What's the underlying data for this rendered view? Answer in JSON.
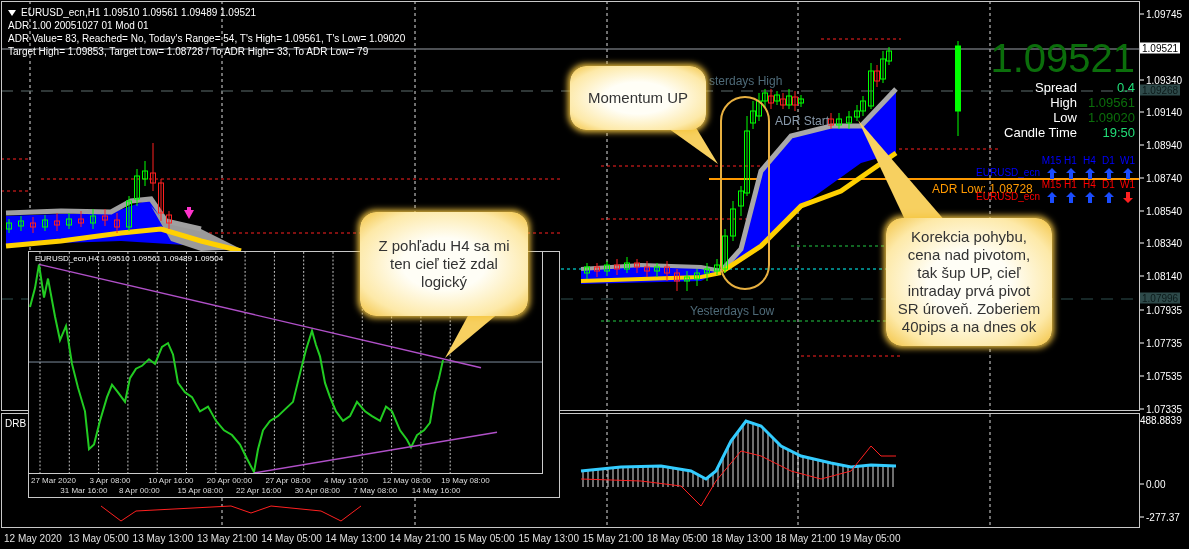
{
  "header": {
    "symbol_line": "EURUSD_ecn,H1  1.09510 1.09561 1.09489 1.09521",
    "lines": [
      "ADR 1.00 20051027 01 Mod 01",
      "ADR Value= 83, Reached= No, Today's Range= 54, T's High= 1.09561, T's Low= 1.09020",
      "Target High= 1.09853, Target Low= 1.08728 / To ADR High= 33, To ADR Low= 79"
    ]
  },
  "price_panel": {
    "price": "1.09521",
    "rows": [
      {
        "label": "Spread",
        "value": "0.4",
        "color": "#22dd77"
      },
      {
        "label": "High",
        "value": "1.09561",
        "color": "#0b6e0b"
      },
      {
        "label": "Low",
        "value": "1.09020",
        "color": "#0b6e0b"
      },
      {
        "label": "Candle Time",
        "value": "19:50",
        "color": "#22dd77"
      }
    ]
  },
  "trend_table": {
    "rows": [
      {
        "symbol": "EURUSD_ecn",
        "color": "#0000ff",
        "timeframes": [
          {
            "label": "M15",
            "rising": true
          },
          {
            "label": "H1",
            "rising": true
          },
          {
            "label": "H4",
            "rising": true
          },
          {
            "label": "D1",
            "rising": true
          },
          {
            "label": "W1",
            "rising": true
          }
        ]
      },
      {
        "symbol": "EURUSD_ecn",
        "color": "#ff0000",
        "timeframes": [
          {
            "label": "M15",
            "rising": true
          },
          {
            "label": "H1",
            "rising": true
          },
          {
            "label": "H4",
            "rising": true
          },
          {
            "label": "D1",
            "rising": true
          },
          {
            "label": "W1",
            "rising": false
          }
        ]
      }
    ]
  },
  "chart_labels": [
    {
      "kind": "level",
      "text": "sterdays High"
    },
    {
      "kind": "start",
      "text": "ADR Start"
    },
    {
      "kind": "level",
      "text": "Yesterdays Low"
    },
    {
      "kind": "adr",
      "text": "ADR Low: 1.08728"
    }
  ],
  "price_axis": [
    {
      "kind": "tick",
      "text": "1.09745"
    },
    {
      "kind": "bid",
      "text": "1.09521"
    },
    {
      "kind": "tick",
      "text": "1.09340"
    },
    {
      "kind": "line",
      "text": "1.09268"
    },
    {
      "kind": "tick",
      "text": "1.09140"
    },
    {
      "kind": "tick",
      "text": "1.08940"
    },
    {
      "kind": "tick",
      "text": "1.08740"
    },
    {
      "kind": "tick",
      "text": "1.08540"
    },
    {
      "kind": "tick",
      "text": "1.08340"
    },
    {
      "kind": "tick",
      "text": "1.08140"
    },
    {
      "kind": "line",
      "text": "1.07996"
    },
    {
      "kind": "tick",
      "text": "1.07935"
    },
    {
      "kind": "tick",
      "text": "1.07735"
    },
    {
      "kind": "tick",
      "text": "1.07535"
    },
    {
      "kind": "tick",
      "text": "1.07335"
    }
  ],
  "indicator": {
    "name": "DRB",
    "axis": [
      "488.8839",
      "0.00",
      "-277.37"
    ]
  },
  "time_axis": [
    "12 May 2020",
    "13 May 05:00",
    "13 May 13:00",
    "13 May 21:00",
    "14 May 05:00",
    "14 May 13:00",
    "14 May 21:00",
    "15 May 05:00",
    "15 May 13:00",
    "15 May 21:00",
    "18 May 05:00",
    "18 May 13:00",
    "18 May 21:00",
    "19 May 05:00"
  ],
  "inset": {
    "header": "EURUSD_ecn,H4  1.09510 1.09561 1.09489 1.09504",
    "dates": [
      "27 Mar 2020",
      "31 Mar 16:00",
      "3 Apr 08:00",
      "8 Apr 00:00",
      "10 Apr 16:00",
      "15 Apr 08:00",
      "20 Apr 00:00",
      "22 Apr 16:00",
      "27 Apr 08:00",
      "30 Apr 08:00",
      "4 May 16:00",
      "7 May 08:00",
      "12 May 08:00",
      "14 May 16:00",
      "19 May 08:00"
    ]
  },
  "callouts": [
    {
      "text": "Momentum UP"
    },
    {
      "text": "Korekcia pohybu, cena nad pivotom, tak šup UP, cieľ intraday prvá pivot SR úroveň. Zoberiem 40pips a na dnes ok"
    },
    {
      "text": "Z pohľadu H4 sa mi ten cieľ tiež zdal logický"
    }
  ]
}
